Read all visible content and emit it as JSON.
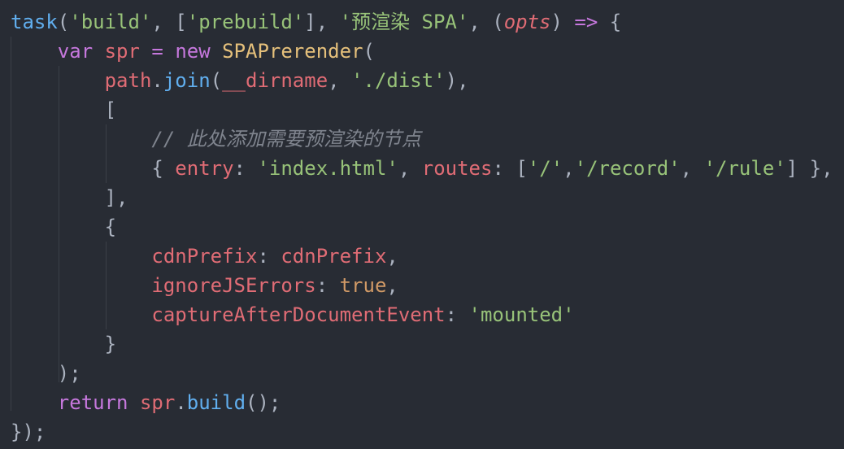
{
  "editor": {
    "background": "#282c34",
    "colors": {
      "plain": "#abb2bf",
      "keyword": "#c678dd",
      "function": "#61afef",
      "string": "#98c379",
      "variable": "#e06c75",
      "class": "#e5c07b",
      "boolean": "#d19a66",
      "comment": "#7f848e"
    },
    "lines": [
      [
        {
          "t": "task",
          "c": "fn"
        },
        {
          "t": "(",
          "c": "plain"
        },
        {
          "t": "'build'",
          "c": "str"
        },
        {
          "t": ", [",
          "c": "plain"
        },
        {
          "t": "'prebuild'",
          "c": "str"
        },
        {
          "t": "], ",
          "c": "plain"
        },
        {
          "t": "'预渲染 SPA'",
          "c": "str"
        },
        {
          "t": ", (",
          "c": "plain"
        },
        {
          "t": "opts",
          "c": "param"
        },
        {
          "t": ") ",
          "c": "plain"
        },
        {
          "t": "=>",
          "c": "kw"
        },
        {
          "t": " {",
          "c": "plain"
        }
      ],
      [
        {
          "t": "    ",
          "c": "plain"
        },
        {
          "t": "var",
          "c": "kw"
        },
        {
          "t": " ",
          "c": "plain"
        },
        {
          "t": "spr",
          "c": "var"
        },
        {
          "t": " ",
          "c": "plain"
        },
        {
          "t": "=",
          "c": "kw"
        },
        {
          "t": " ",
          "c": "plain"
        },
        {
          "t": "new",
          "c": "kw"
        },
        {
          "t": " ",
          "c": "plain"
        },
        {
          "t": "SPAPrerender",
          "c": "cls"
        },
        {
          "t": "(",
          "c": "plain"
        }
      ],
      [
        {
          "t": "        ",
          "c": "plain"
        },
        {
          "t": "path",
          "c": "var"
        },
        {
          "t": ".",
          "c": "plain"
        },
        {
          "t": "join",
          "c": "fn"
        },
        {
          "t": "(",
          "c": "plain"
        },
        {
          "t": "__dirname",
          "c": "var"
        },
        {
          "t": ", ",
          "c": "plain"
        },
        {
          "t": "'./dist'",
          "c": "str"
        },
        {
          "t": "),",
          "c": "plain"
        }
      ],
      [
        {
          "t": "        [",
          "c": "plain"
        }
      ],
      [
        {
          "t": "            ",
          "c": "plain"
        },
        {
          "t": "// 此处添加需要预渲染的节点",
          "c": "cmt"
        }
      ],
      [
        {
          "t": "            { ",
          "c": "plain"
        },
        {
          "t": "entry",
          "c": "var"
        },
        {
          "t": ": ",
          "c": "plain"
        },
        {
          "t": "'index.html'",
          "c": "str"
        },
        {
          "t": ", ",
          "c": "plain"
        },
        {
          "t": "routes",
          "c": "var"
        },
        {
          "t": ": [",
          "c": "plain"
        },
        {
          "t": "'/'",
          "c": "str"
        },
        {
          "t": ",",
          "c": "plain"
        },
        {
          "t": "'/record'",
          "c": "str"
        },
        {
          "t": ", ",
          "c": "plain"
        },
        {
          "t": "'/rule'",
          "c": "str"
        },
        {
          "t": "] },",
          "c": "plain"
        }
      ],
      [
        {
          "t": "        ],",
          "c": "plain"
        }
      ],
      [
        {
          "t": "        {",
          "c": "plain"
        }
      ],
      [
        {
          "t": "            ",
          "c": "plain"
        },
        {
          "t": "cdnPrefix",
          "c": "var"
        },
        {
          "t": ": ",
          "c": "plain"
        },
        {
          "t": "cdnPrefix",
          "c": "var"
        },
        {
          "t": ",",
          "c": "plain"
        }
      ],
      [
        {
          "t": "            ",
          "c": "plain"
        },
        {
          "t": "ignoreJSErrors",
          "c": "var"
        },
        {
          "t": ": ",
          "c": "plain"
        },
        {
          "t": "true",
          "c": "bool"
        },
        {
          "t": ",",
          "c": "plain"
        }
      ],
      [
        {
          "t": "            ",
          "c": "plain"
        },
        {
          "t": "captureAfterDocumentEvent",
          "c": "var"
        },
        {
          "t": ": ",
          "c": "plain"
        },
        {
          "t": "'mounted'",
          "c": "str"
        }
      ],
      [
        {
          "t": "        }",
          "c": "plain"
        }
      ],
      [
        {
          "t": "    );",
          "c": "plain"
        }
      ],
      [
        {
          "t": "    ",
          "c": "plain"
        },
        {
          "t": "return",
          "c": "kw"
        },
        {
          "t": " ",
          "c": "plain"
        },
        {
          "t": "spr",
          "c": "var"
        },
        {
          "t": ".",
          "c": "plain"
        },
        {
          "t": "build",
          "c": "fn"
        },
        {
          "t": "();",
          "c": "plain"
        }
      ],
      [
        {
          "t": "});",
          "c": "plain"
        }
      ]
    ]
  }
}
